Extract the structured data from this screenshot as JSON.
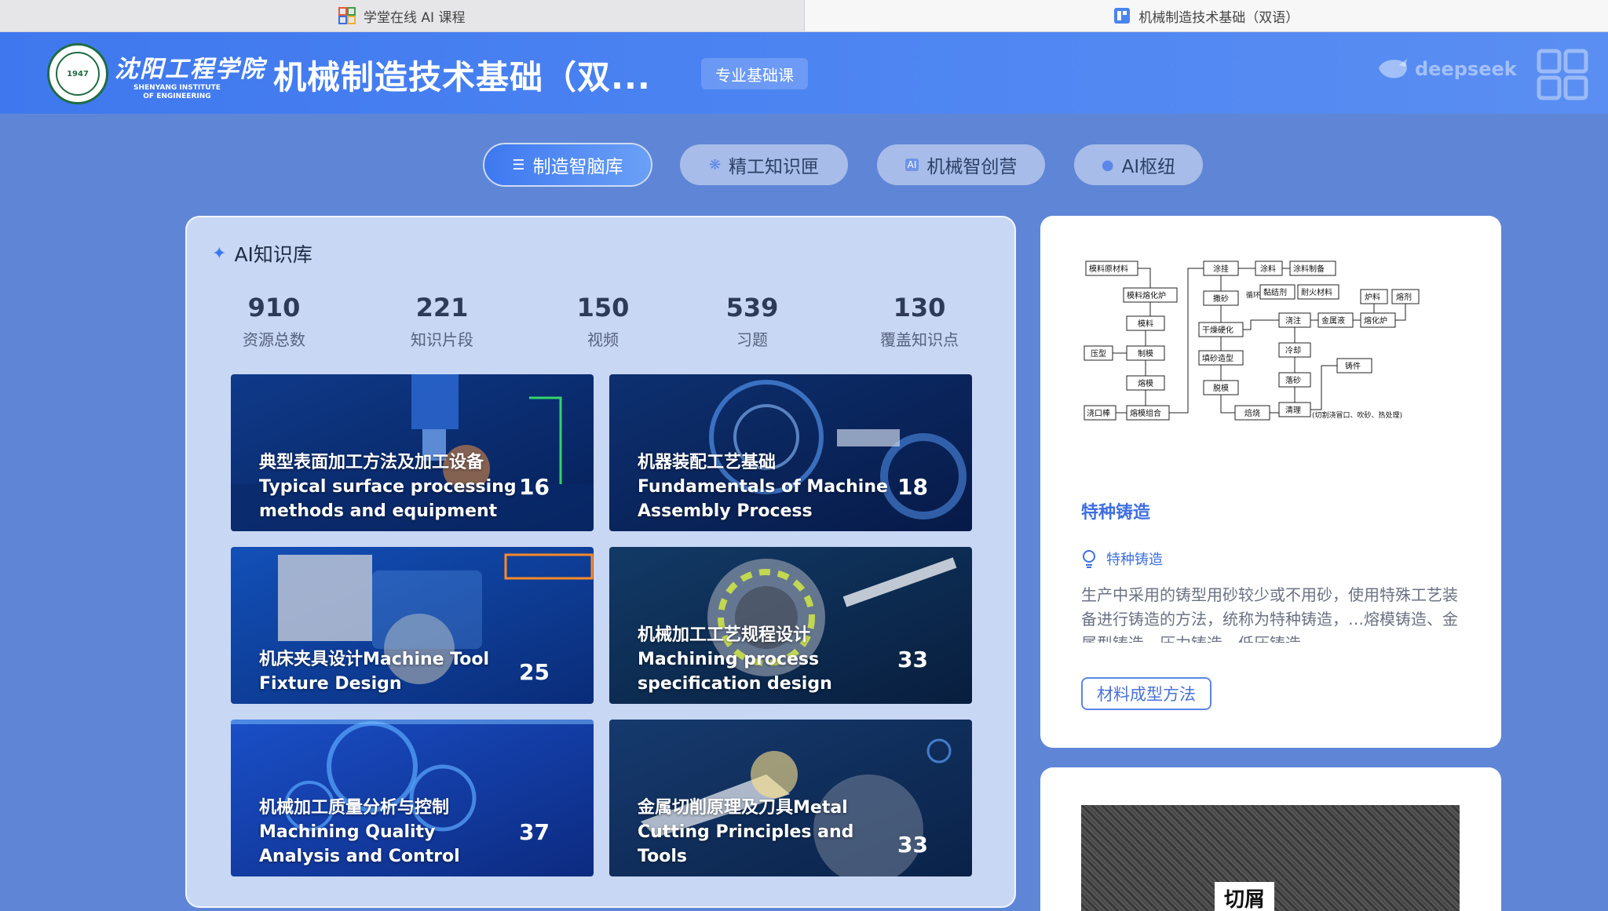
{
  "browser": {
    "tabs": [
      {
        "label": "学堂在线 AI 课程",
        "active": false
      },
      {
        "label": "机械制造技术基础（双语）",
        "active": true
      }
    ]
  },
  "header": {
    "school_name": "沈阳工程学院",
    "school_en_1": "SHENYANG INSTITUTE",
    "school_en_2": "OF ENGINEERING",
    "seal_year": "1947",
    "course_title": "机械制造技术基础（双...",
    "course_badge": "专业基础课",
    "partner": "deepseek"
  },
  "nav": {
    "tabs": [
      {
        "label": "制造智脑库",
        "icon": "layers-icon",
        "active": true
      },
      {
        "label": "精工知识匣",
        "icon": "sparkle-icon",
        "active": false
      },
      {
        "label": "机械智创营",
        "icon": "ai-chip-icon",
        "active": false
      },
      {
        "label": "AI枢纽",
        "icon": "users-icon",
        "active": false
      }
    ]
  },
  "knowledge_base": {
    "title": "AI知识库",
    "stats": [
      {
        "value": "910",
        "label": "资源总数"
      },
      {
        "value": "221",
        "label": "知识片段"
      },
      {
        "value": "150",
        "label": "视频"
      },
      {
        "value": "539",
        "label": "习题"
      },
      {
        "value": "130",
        "label": "覆盖知识点"
      }
    ],
    "categories": [
      {
        "title": "典型表面加工方法及加工设备Typical surface processing methods and equipment",
        "count": "16"
      },
      {
        "title": "机器装配工艺基础Fundamentals of Machine Assembly Process",
        "count": "18"
      },
      {
        "title": "机床夹具设计Machine Tool Fixture Design",
        "count": "25"
      },
      {
        "title": "机械加工工艺规程设计Machining process specification design",
        "count": "33"
      },
      {
        "title": "机械加工质量分析与控制Machining Quality Analysis and Control",
        "count": "37"
      },
      {
        "title": "金属切削原理及刀具Metal Cutting Principles and Tools",
        "count": "33"
      }
    ]
  },
  "detail": {
    "flow_nodes": [
      "模料原材料",
      "模料熔化炉",
      "模料",
      "制模",
      "熔模",
      "熔模组合",
      "压型",
      "浇口棒",
      "涂挂",
      "撒砂",
      "干燥硬化",
      "填砂造型",
      "脱模",
      "焙烧",
      "涂料",
      "涂料制备",
      "黏结剂",
      "耐火材料",
      "循环",
      "浇注",
      "冷却",
      "落砂",
      "清理",
      "铸件",
      "炉料",
      "熔剂",
      "熔化炉",
      "金属液",
      "(切割浇冒口、吹砂、热处理)"
    ],
    "title": "特种铸造",
    "knowledge_point": "特种铸造",
    "description": "生产中采用的铸型用砂较少或不用砂，使用特殊工艺装备进行铸造的方法，统称为特种铸造，…熔模铸造、金属型铸造、压力铸造、低压铸造",
    "tag": "材料成型方法"
  },
  "photo": {
    "label": "切屑"
  }
}
